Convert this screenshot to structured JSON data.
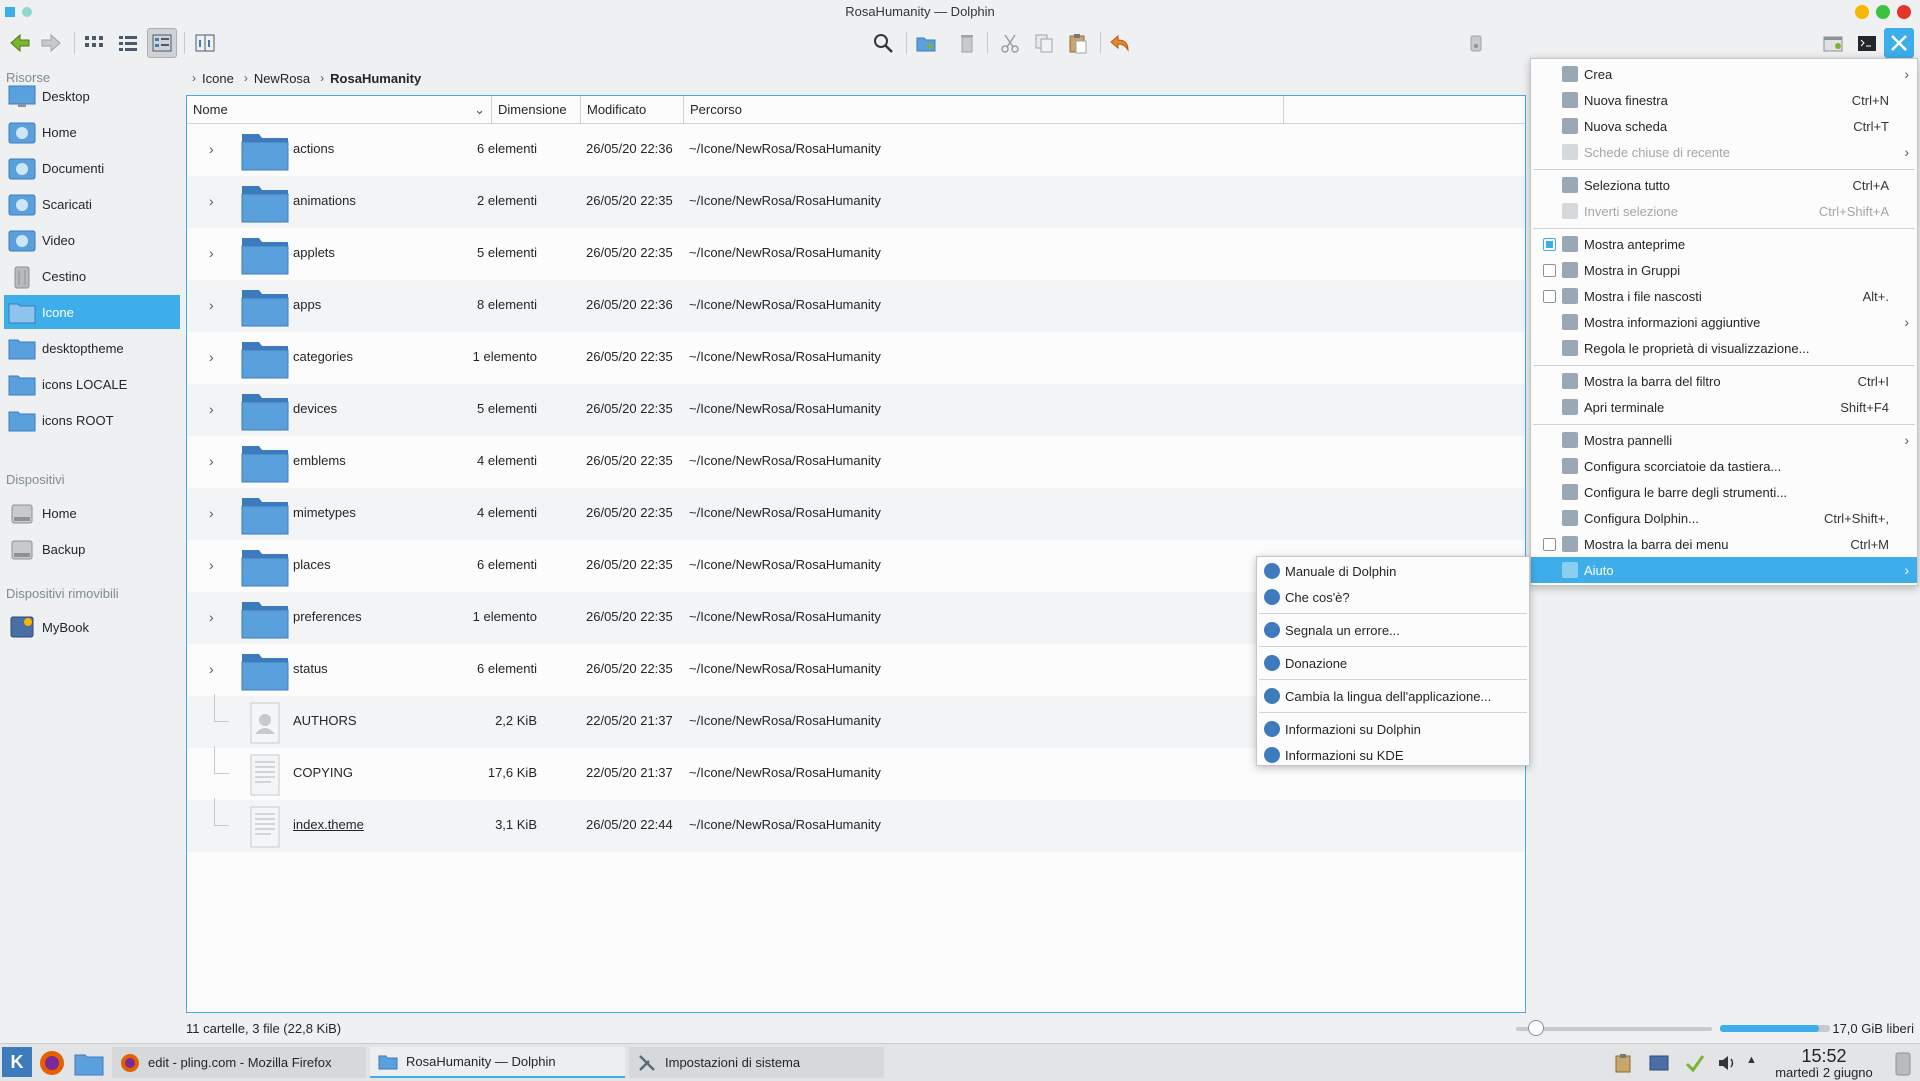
{
  "window": {
    "title": "RosaHumanity — Dolphin"
  },
  "sidebar": {
    "sections": [
      {
        "heading": "Risorse",
        "items": [
          "Desktop",
          "Home",
          "Documenti",
          "Scaricati",
          "Video",
          "Cestino",
          "Icone",
          "desktoptheme",
          "icons LOCALE",
          "icons ROOT"
        ]
      },
      {
        "heading": "Dispositivi",
        "items": [
          "Home",
          "Backup"
        ]
      },
      {
        "heading": "Dispositivi rimovibili",
        "items": [
          "MyBook"
        ]
      }
    ],
    "selected": "Icone"
  },
  "breadcrumb": [
    "Icone",
    "NewRosa",
    "RosaHumanity"
  ],
  "columns": [
    "Nome",
    "Dimensione",
    "Modificato",
    "Percorso"
  ],
  "files": [
    {
      "name": "actions",
      "size": "6 elementi",
      "modified": "26/05/20 22:36",
      "path": "~/Icone/NewRosa/RosaHumanity",
      "type": "folder"
    },
    {
      "name": "animations",
      "size": "2 elementi",
      "modified": "26/05/20 22:35",
      "path": "~/Icone/NewRosa/RosaHumanity",
      "type": "folder"
    },
    {
      "name": "applets",
      "size": "5 elementi",
      "modified": "26/05/20 22:35",
      "path": "~/Icone/NewRosa/RosaHumanity",
      "type": "folder"
    },
    {
      "name": "apps",
      "size": "8 elementi",
      "modified": "26/05/20 22:36",
      "path": "~/Icone/NewRosa/RosaHumanity",
      "type": "folder"
    },
    {
      "name": "categories",
      "size": "1 elemento",
      "modified": "26/05/20 22:35",
      "path": "~/Icone/NewRosa/RosaHumanity",
      "type": "folder"
    },
    {
      "name": "devices",
      "size": "5 elementi",
      "modified": "26/05/20 22:35",
      "path": "~/Icone/NewRosa/RosaHumanity",
      "type": "folder"
    },
    {
      "name": "emblems",
      "size": "4 elementi",
      "modified": "26/05/20 22:35",
      "path": "~/Icone/NewRosa/RosaHumanity",
      "type": "folder"
    },
    {
      "name": "mimetypes",
      "size": "4 elementi",
      "modified": "26/05/20 22:35",
      "path": "~/Icone/NewRosa/RosaHumanity",
      "type": "folder"
    },
    {
      "name": "places",
      "size": "6 elementi",
      "modified": "26/05/20 22:35",
      "path": "~/Icone/NewRosa/RosaHumanity",
      "type": "folder"
    },
    {
      "name": "preferences",
      "size": "1 elemento",
      "modified": "26/05/20 22:35",
      "path": "~/Icone/NewRosa/RosaHumanity",
      "type": "folder"
    },
    {
      "name": "status",
      "size": "6 elementi",
      "modified": "26/05/20 22:35",
      "path": "~/Icone/NewRosa/RosaHumanity",
      "type": "folder"
    },
    {
      "name": "AUTHORS",
      "size": "2,2 KiB",
      "modified": "22/05/20 21:37",
      "path": "~/Icone/NewRosa/RosaHumanity",
      "type": "authors"
    },
    {
      "name": "COPYING",
      "size": "17,6 KiB",
      "modified": "22/05/20 21:37",
      "path": "~/Icone/NewRosa/RosaHumanity",
      "type": "text"
    },
    {
      "name": "index.theme",
      "size": "3,1 KiB",
      "modified": "26/05/20 22:44",
      "path": "~/Icone/NewRosa/RosaHumanity",
      "type": "text"
    }
  ],
  "status": {
    "summary": "11 cartelle, 3 file (22,8 KiB)",
    "free": "17,0 GiB liberi",
    "zoom_level": 0.1,
    "free_fraction": 0.9
  },
  "main_menu": [
    {
      "label": "Crea",
      "shortcut": "",
      "submenu": true,
      "state": "normal"
    },
    {
      "label": "Nuova finestra",
      "shortcut": "Ctrl+N",
      "state": "normal"
    },
    {
      "label": "Nuova scheda",
      "shortcut": "Ctrl+T",
      "state": "normal"
    },
    {
      "label": "Schede chiuse di recente",
      "shortcut": "",
      "submenu": true,
      "state": "disabled"
    },
    {
      "sep": true
    },
    {
      "label": "Seleziona tutto",
      "shortcut": "Ctrl+A",
      "state": "normal"
    },
    {
      "label": "Inverti selezione",
      "shortcut": "Ctrl+Shift+A",
      "state": "disabled"
    },
    {
      "sep": true
    },
    {
      "label": "Mostra anteprime",
      "shortcut": "",
      "check": "on",
      "state": "normal"
    },
    {
      "label": "Mostra in Gruppi",
      "shortcut": "",
      "check": "off",
      "state": "normal"
    },
    {
      "label": "Mostra i file nascosti",
      "shortcut": "Alt+.",
      "check": "off",
      "state": "normal"
    },
    {
      "label": "Mostra informazioni aggiuntive",
      "shortcut": "",
      "submenu": true,
      "state": "normal"
    },
    {
      "label": "Regola le proprietà di visualizzazione...",
      "shortcut": "",
      "state": "normal"
    },
    {
      "sep": true
    },
    {
      "label": "Mostra la barra del filtro",
      "shortcut": "Ctrl+I",
      "state": "normal"
    },
    {
      "label": "Apri terminale",
      "shortcut": "Shift+F4",
      "state": "normal"
    },
    {
      "sep": true
    },
    {
      "label": "Mostra pannelli",
      "shortcut": "",
      "submenu": true,
      "state": "normal"
    },
    {
      "label": "Configura scorciatoie da tastiera...",
      "shortcut": "",
      "state": "normal"
    },
    {
      "label": "Configura le barre degli strumenti...",
      "shortcut": "",
      "state": "normal"
    },
    {
      "label": "Configura Dolphin...",
      "shortcut": "Ctrl+Shift+,",
      "state": "normal"
    },
    {
      "label": "Mostra la barra dei menu",
      "shortcut": "Ctrl+M",
      "check": "off",
      "state": "normal"
    },
    {
      "label": "Aiuto",
      "shortcut": "",
      "submenu": true,
      "state": "highlighted"
    }
  ],
  "help_menu": [
    {
      "label": "Manuale di Dolphin"
    },
    {
      "label": "Che cos'è?"
    },
    {
      "sep": true
    },
    {
      "label": "Segnala un errore..."
    },
    {
      "sep": true
    },
    {
      "label": "Donazione"
    },
    {
      "sep": true
    },
    {
      "label": "Cambia la lingua dell'applicazione..."
    },
    {
      "sep": true
    },
    {
      "label": "Informazioni su Dolphin"
    },
    {
      "label": "Informazioni su KDE"
    }
  ],
  "taskbar": {
    "tasks": [
      "edit - pling.com - Mozilla Firefox",
      "RosaHumanity — Dolphin",
      "Impostazioni di sistema"
    ],
    "active_task": "RosaHumanity — Dolphin",
    "clock_time": "15:52",
    "clock_date": "martedì 2 giugno"
  },
  "colors": {
    "accent": "#3daee9",
    "folder": "#5aa0dd"
  }
}
